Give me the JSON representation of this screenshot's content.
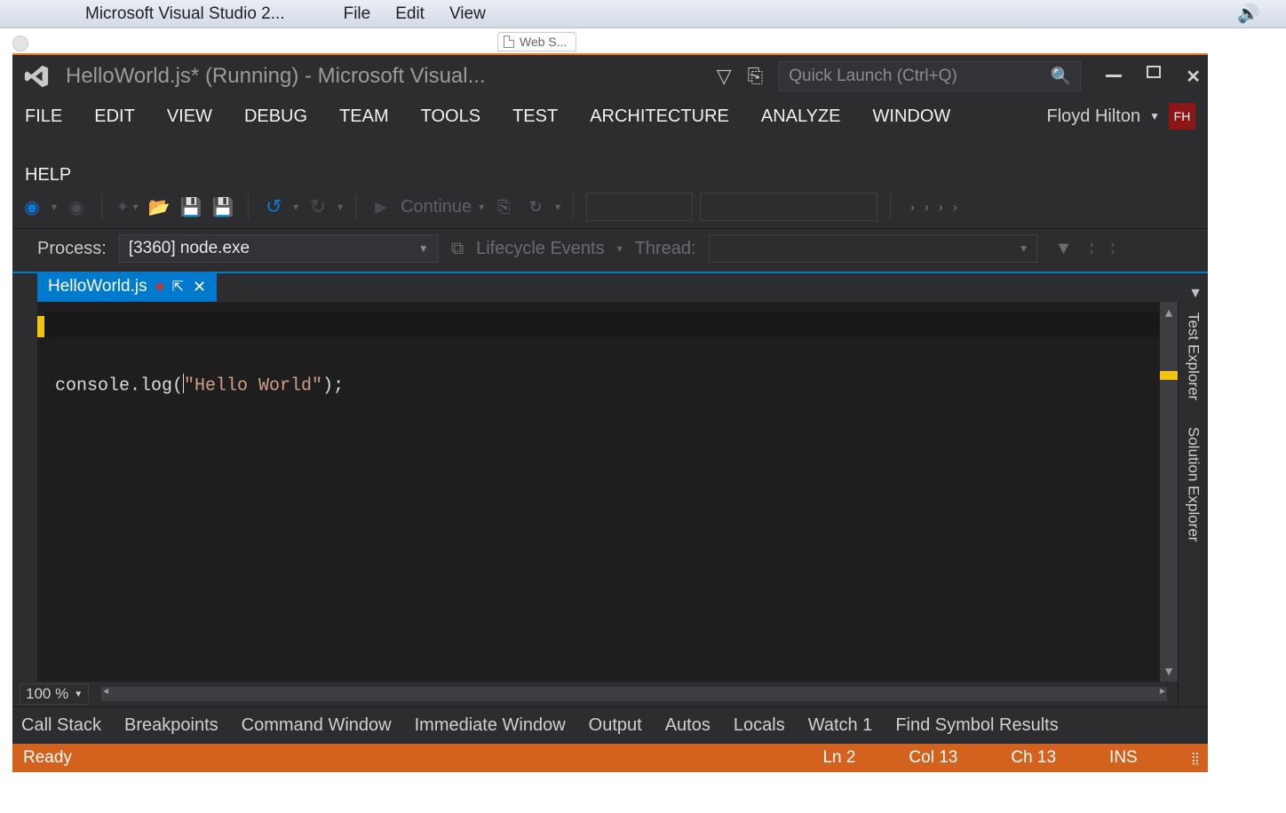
{
  "mac": {
    "app_title": "Microsoft Visual Studio 2...",
    "menus": [
      "File",
      "Edit",
      "View"
    ]
  },
  "peek_tab_label": "Web S...",
  "vs": {
    "title": "HelloWorld.js* (Running) - Microsoft Visual...",
    "quick_launch_placeholder": "Quick Launch (Ctrl+Q)",
    "menus": [
      "FILE",
      "EDIT",
      "VIEW",
      "DEBUG",
      "TEAM",
      "TOOLS",
      "TEST",
      "ARCHITECTURE",
      "ANALYZE",
      "WINDOW",
      "HELP"
    ],
    "user": {
      "name": "Floyd Hilton",
      "initials": "FH"
    },
    "toolbar": {
      "continue_label": "Continue"
    },
    "debugbar": {
      "process_label": "Process:",
      "process_value": "[3360] node.exe",
      "lifecycle_label": "Lifecycle Events",
      "thread_label": "Thread:"
    },
    "doctab": {
      "filename": "HelloWorld.js"
    },
    "code": {
      "ident": "console.log(",
      "string": "\"Hello World\"",
      "tail": ");"
    },
    "zoom": "100 %",
    "tool_tabs": [
      "Call Stack",
      "Breakpoints",
      "Command Window",
      "Immediate Window",
      "Output",
      "Autos",
      "Locals",
      "Watch 1",
      "Find Symbol Results"
    ],
    "side_tabs": [
      "Test Explorer",
      "Solution Explorer"
    ],
    "status": {
      "ready": "Ready",
      "ln": "Ln 2",
      "col": "Col 13",
      "ch": "Ch 13",
      "ins": "INS"
    }
  }
}
